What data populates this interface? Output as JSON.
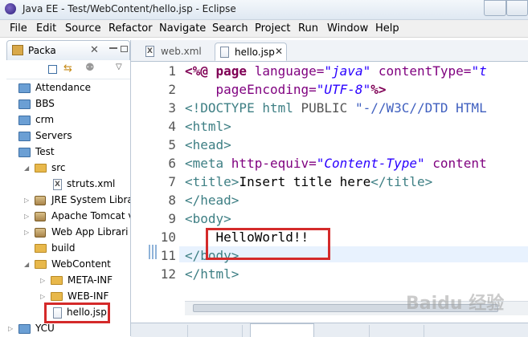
{
  "window": {
    "title": "Java EE - Test/WebContent/hello.jsp - Eclipse"
  },
  "menu": [
    "File",
    "Edit",
    "Source",
    "Refactor",
    "Navigate",
    "Search",
    "Project",
    "Run",
    "Window",
    "Help"
  ],
  "left_panel": {
    "tab_label": "Packa",
    "tree": [
      {
        "label": "Attendance",
        "icon": "project-folder-icon"
      },
      {
        "label": "BBS",
        "icon": "project-folder-icon"
      },
      {
        "label": "crm",
        "icon": "project-folder-icon"
      },
      {
        "label": "Servers",
        "icon": "project-folder-icon"
      },
      {
        "label": "Test",
        "icon": "project-folder-icon"
      },
      {
        "label": "src",
        "icon": "source-folder-icon"
      },
      {
        "label": "struts.xml",
        "icon": "xml-file-icon"
      },
      {
        "label": "JRE System Libra",
        "icon": "library-icon"
      },
      {
        "label": "Apache Tomcat v",
        "icon": "library-icon"
      },
      {
        "label": "Web App Librari",
        "icon": "library-icon"
      },
      {
        "label": "build",
        "icon": "folder-icon"
      },
      {
        "label": "WebContent",
        "icon": "folder-icon"
      },
      {
        "label": "META-INF",
        "icon": "folder-icon"
      },
      {
        "label": "WEB-INF",
        "icon": "folder-icon"
      },
      {
        "label": "hello.jsp",
        "icon": "jsp-file-icon"
      },
      {
        "label": "YCU",
        "icon": "project-folder-icon"
      }
    ]
  },
  "editor": {
    "tabs": [
      {
        "label": "web.xml",
        "active": false
      },
      {
        "label": "hello.jsp",
        "active": true
      }
    ],
    "line_numbers": [
      "1",
      "2",
      "3",
      "4",
      "5",
      "6",
      "7",
      "8",
      "9",
      "10",
      "11",
      "12"
    ],
    "lines": [
      [
        {
          "t": "<%@ ",
          "c": "c-kw"
        },
        {
          "t": "page ",
          "c": "c-kw"
        },
        {
          "t": "language=",
          "c": "c-attr"
        },
        {
          "t": "\"java\" ",
          "c": "c-str"
        },
        {
          "t": "contentType=",
          "c": "c-attr"
        },
        {
          "t": "\"t",
          "c": "c-str"
        }
      ],
      [
        {
          "t": "    pageEncoding=",
          "c": "c-attr"
        },
        {
          "t": "\"UTF-8\"",
          "c": "c-str"
        },
        {
          "t": "%>",
          "c": "c-kw"
        }
      ],
      [
        {
          "t": "<!DOCTYPE ",
          "c": "c-tag"
        },
        {
          "t": "html ",
          "c": "c-tag"
        },
        {
          "t": "PUBLIC ",
          "c": "c-gray"
        },
        {
          "t": "\"-//W3C//DTD HTML",
          "c": "c-doc"
        }
      ],
      [
        {
          "t": "<html>",
          "c": "c-tag"
        }
      ],
      [
        {
          "t": "<head>",
          "c": "c-tag"
        }
      ],
      [
        {
          "t": "<meta ",
          "c": "c-tag"
        },
        {
          "t": "http-equiv=",
          "c": "c-attr"
        },
        {
          "t": "\"Content-Type\" ",
          "c": "c-str"
        },
        {
          "t": "content",
          "c": "c-attr"
        }
      ],
      [
        {
          "t": "<title>",
          "c": "c-tag"
        },
        {
          "t": "Insert title here",
          "c": "c-txt"
        },
        {
          "t": "</title>",
          "c": "c-tag"
        }
      ],
      [
        {
          "t": "</head>",
          "c": "c-tag"
        }
      ],
      [
        {
          "t": "<body>",
          "c": "c-tag"
        }
      ],
      [
        {
          "t": "    HelloWorld!!",
          "c": "c-txt"
        }
      ],
      [
        {
          "t": "</body>",
          "c": "c-tag"
        }
      ],
      [
        {
          "t": "</html>",
          "c": "c-tag"
        }
      ]
    ]
  },
  "watermark": "Baidu 经验",
  "colors": {
    "highlight": "#d42a2a",
    "tag": "#3e7f84",
    "keyword": "#7f0055",
    "string": "#2a00ff"
  }
}
